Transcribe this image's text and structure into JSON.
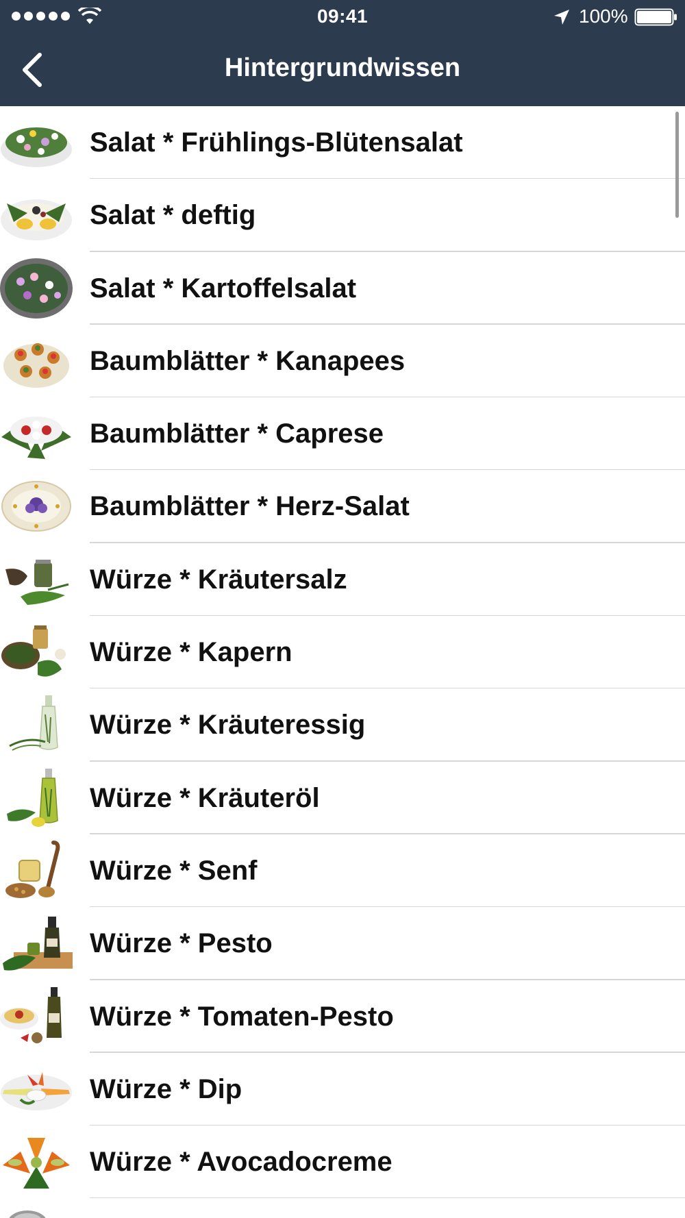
{
  "status_bar": {
    "time": "09:41",
    "battery": "100%"
  },
  "nav": {
    "title": "Hintergrundwissen",
    "back_icon": "chevron-left-icon"
  },
  "colors": {
    "header_bg": "#2d3b4e",
    "separator": "#d6d6d6"
  },
  "list": {
    "items": [
      {
        "label": "Salat * Frühlings-Blütensalat",
        "thumb": "flower-salad"
      },
      {
        "label": "Salat * deftig",
        "thumb": "egg-salad"
      },
      {
        "label": "Salat * Kartoffelsalat",
        "thumb": "potato-salad"
      },
      {
        "label": "Baumblätter * Kanapees",
        "thumb": "canapes"
      },
      {
        "label": "Baumblätter * Caprese",
        "thumb": "caprese"
      },
      {
        "label": "Baumblätter * Herz-Salat",
        "thumb": "heart-salad"
      },
      {
        "label": "Würze * Kräutersalz",
        "thumb": "herb-salt"
      },
      {
        "label": "Würze * Kapern",
        "thumb": "capers"
      },
      {
        "label": "Würze * Kräuteressig",
        "thumb": "herb-vinegar"
      },
      {
        "label": "Würze * Kräuteröl",
        "thumb": "herb-oil"
      },
      {
        "label": "Würze * Senf",
        "thumb": "mustard"
      },
      {
        "label": "Würze * Pesto",
        "thumb": "pesto"
      },
      {
        "label": "Würze * Tomaten-Pesto",
        "thumb": "tomato-pesto"
      },
      {
        "label": "Würze * Dip",
        "thumb": "dip"
      },
      {
        "label": "Würze * Avocadocreme",
        "thumb": "avocado-cream"
      },
      {
        "label": "",
        "thumb": "partial-item"
      }
    ]
  }
}
